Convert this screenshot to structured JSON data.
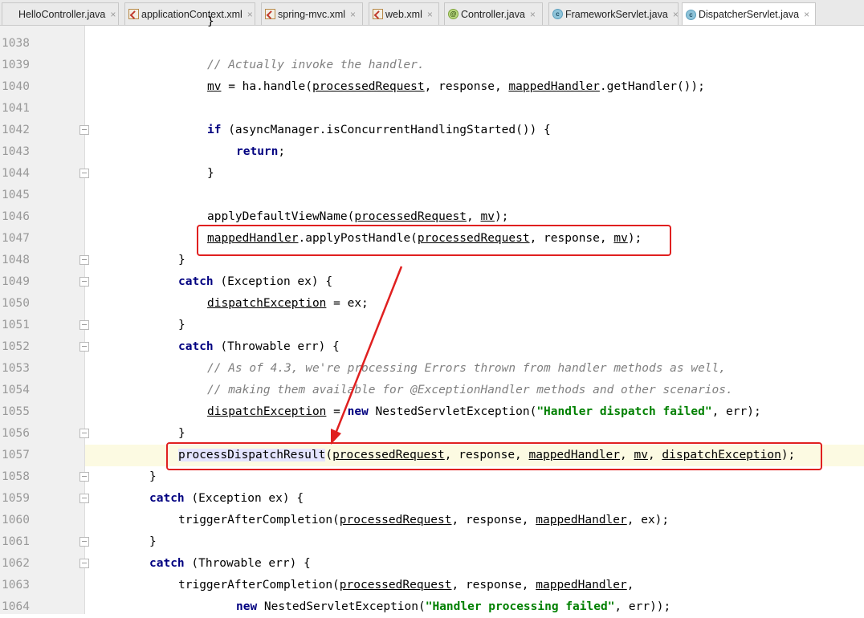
{
  "tabs": [
    {
      "label": "HelloController.java",
      "icon": "class-icon"
    },
    {
      "label": "applicationContext.xml",
      "icon": "xml-file-icon"
    },
    {
      "label": "spring-mvc.xml",
      "icon": "xml-file-icon"
    },
    {
      "label": "web.xml",
      "icon": "xml-file-icon"
    },
    {
      "label": "Controller.java",
      "icon": "annotation-icon"
    },
    {
      "label": "FrameworkServlet.java",
      "icon": "class-icon"
    },
    {
      "label": "DispatcherServlet.java",
      "icon": "class-icon",
      "active": true
    }
  ],
  "tab_close_glyph": "×",
  "line_numbers": [
    "1038",
    "1039",
    "1040",
    "1041",
    "1042",
    "1043",
    "1044",
    "1045",
    "1046",
    "1047",
    "1048",
    "1049",
    "1050",
    "1051",
    "1052",
    "1053",
    "1054",
    "1055",
    "1056",
    "1057",
    "1058",
    "1059",
    "1060",
    "1061",
    "1062",
    "1063",
    "1064"
  ],
  "code": {
    "l1039": "// Actually invoke the handler.",
    "l1040_a": "mv",
    "l1040_b": " = ha.handle(",
    "l1040_c": "processedRequest",
    "l1040_d": ", response, ",
    "l1040_e": "mappedHandler",
    "l1040_f": ".getHandler());",
    "l1042_kw": "if",
    "l1042_rest": " (asyncManager.isConcurrentHandlingStarted()) {",
    "l1043_kw": "return",
    "l1043_rest": ";",
    "l1044": "}",
    "l1046_a": "applyDefaultViewName(",
    "l1046_b": "processedRequest",
    "l1046_c": ", ",
    "l1046_d": "mv",
    "l1046_e": ");",
    "l1047_a": "mappedHandler",
    "l1047_b": ".applyPostHandle(",
    "l1047_c": "processedRequest",
    "l1047_d": ", response, ",
    "l1047_e": "mv",
    "l1047_f": ");",
    "l1048": "}",
    "l1049_kw": "catch",
    "l1049_rest": " (Exception ex) {",
    "l1050_a": "dispatchException",
    "l1050_b": " = ex;",
    "l1051": "}",
    "l1052_kw": "catch",
    "l1052_rest": " (Throwable err) {",
    "l1053": "// As of 4.3, we're processing Errors thrown from handler methods as well,",
    "l1054": "// making them available for @ExceptionHandler methods and other scenarios.",
    "l1055_a": "dispatchException",
    "l1055_b": " = ",
    "l1055_kw": "new",
    "l1055_c": " NestedServletException(",
    "l1055_str": "\"Handler dispatch failed\"",
    "l1055_d": ", err);",
    "l1056": "}",
    "l1057_a": "processDispatchResult",
    "l1057_b": "(",
    "l1057_c": "processedRequest",
    "l1057_d": ", response, ",
    "l1057_e": "mappedHandler",
    "l1057_f": ", ",
    "l1057_g": "mv",
    "l1057_h": ", ",
    "l1057_i": "dispatchException",
    "l1057_j": ");",
    "l1058": "}",
    "l1059_kw": "catch",
    "l1059_rest": " (Exception ex) {",
    "l1060_a": "triggerAfterCompletion(",
    "l1060_b": "processedRequest",
    "l1060_c": ", response, ",
    "l1060_d": "mappedHandler",
    "l1060_e": ", ex);",
    "l1061": "}",
    "l1062_kw": "catch",
    "l1062_rest": " (Throwable err) {",
    "l1063_a": "triggerAfterCompletion(",
    "l1063_b": "processedRequest",
    "l1063_c": ", response, ",
    "l1063_d": "mappedHandler",
    "l1063_e": ",",
    "l1064_kw": "new",
    "l1064_a": " NestedServletException(",
    "l1064_str": "\"Handler processing failed\"",
    "l1064_b": ", err));",
    "l1037_top": "}"
  },
  "colors": {
    "annotation_red": "#e02020",
    "keyword": "#000080",
    "comment": "#808080",
    "string": "#008000",
    "current_line": "#fcfae2"
  }
}
